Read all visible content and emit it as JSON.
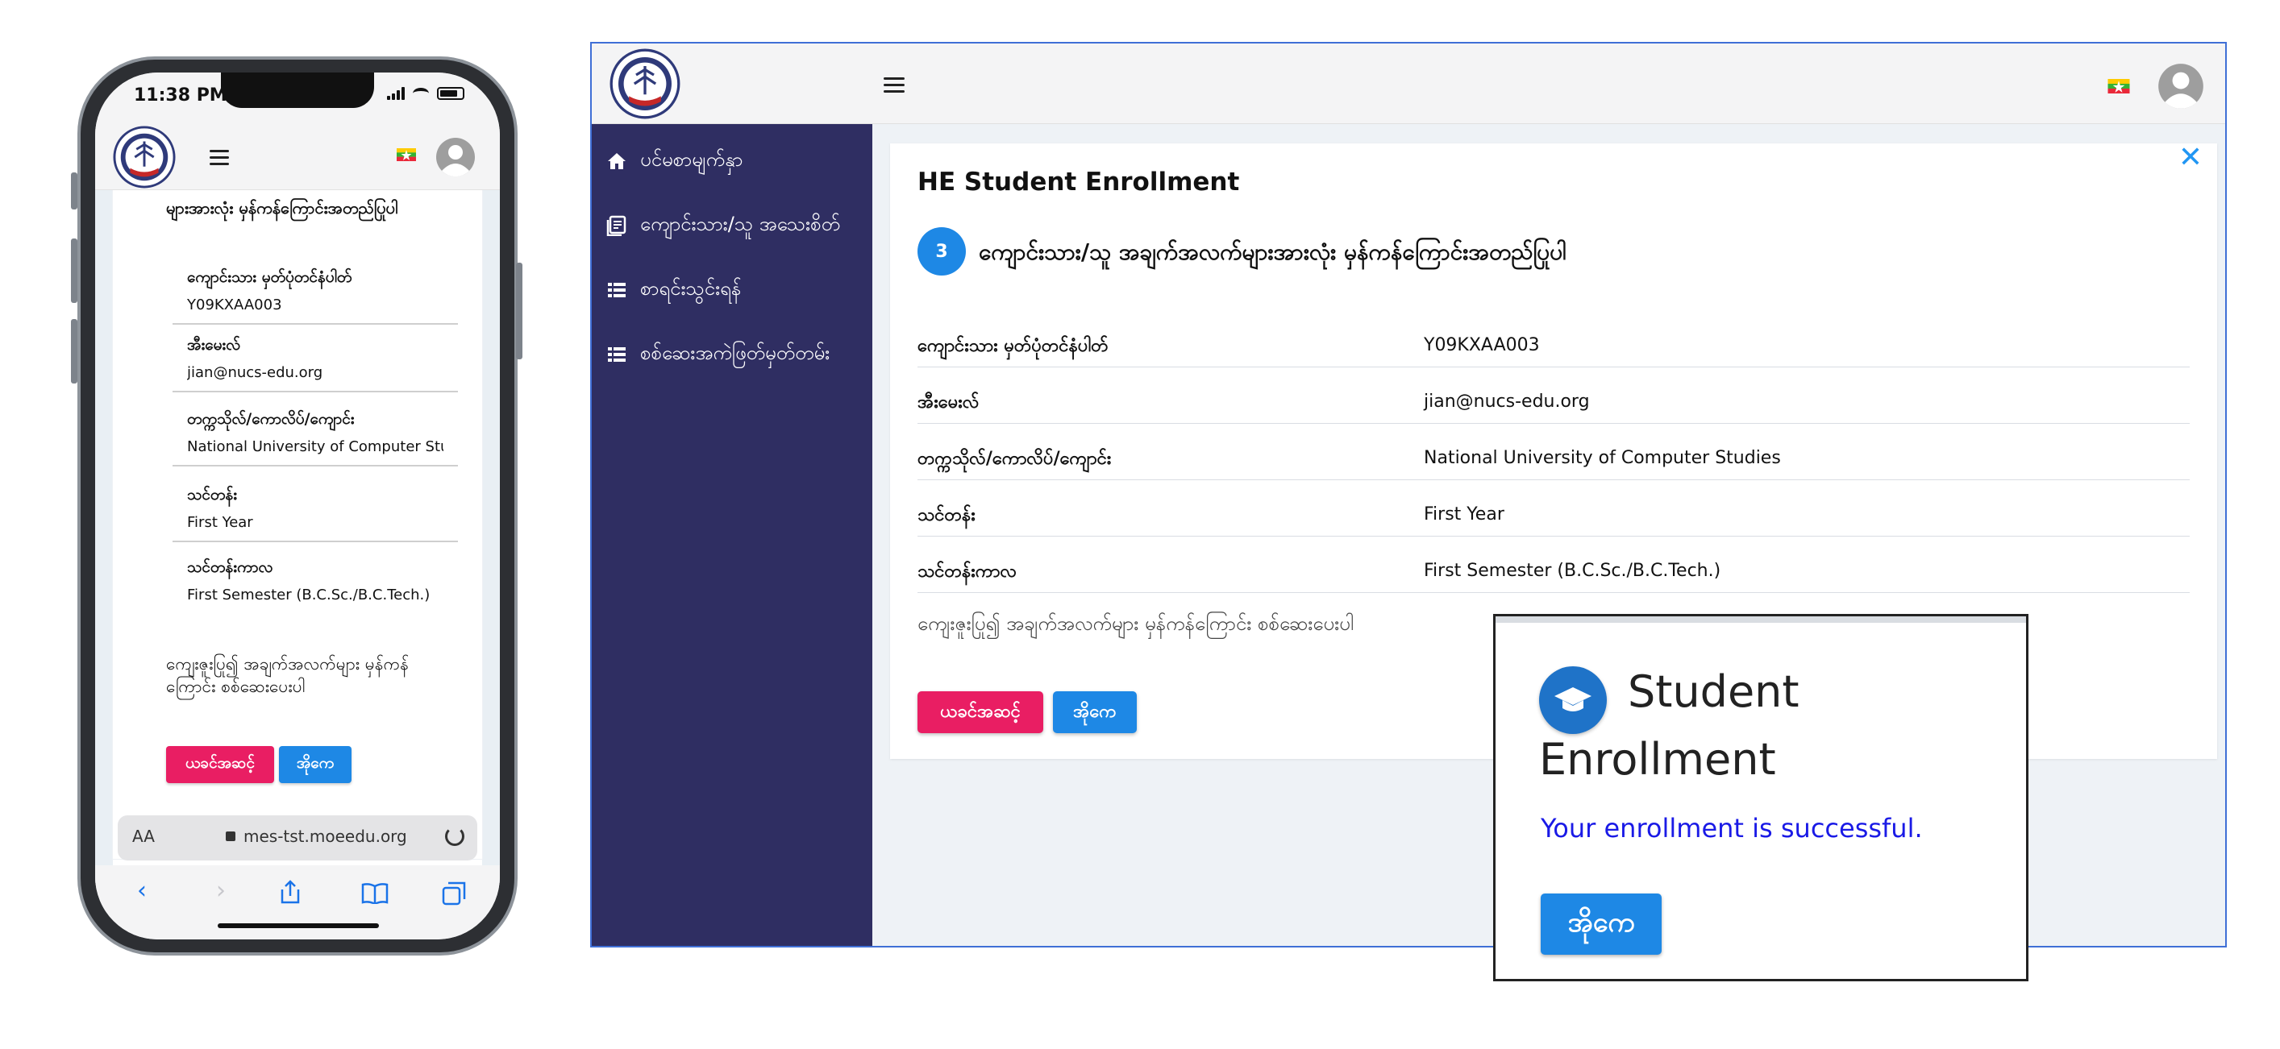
{
  "colors": {
    "primary": "#1e88e5",
    "danger": "#e91e63",
    "sidebar": "#2f2e62",
    "success_text": "#1a1ae6"
  },
  "mobile": {
    "status": {
      "time": "11:38 PM"
    },
    "step_title": "များအားလုံး မှန်ကန်ကြောင်းအတည်ပြုပါ",
    "fields": [
      {
        "label": "ကျောင်းသား မှတ်ပုံတင်နံပါတ်",
        "value": "Y09KXAA003"
      },
      {
        "label": "အီးမေးလ်",
        "value": "jian@nucs-edu.org"
      },
      {
        "label": "တက္ကသိုလ်/ကောလိပ်/ကျောင်း",
        "value": "National University of Computer Studi"
      },
      {
        "label": "သင်တန်း",
        "value": "First Year"
      },
      {
        "label": "သင်တန်းကာလ",
        "value": "First Semester (B.C.Sc./B.C.Tech.)"
      }
    ],
    "confirm_text": "ကျေးဇူးပြု၍ အချက်အလက်များ မှန်ကန်ကြောင်း စစ်ဆေးပေးပါ",
    "back_label": "ယခင်အဆင့်",
    "ok_label": "အိုကေ",
    "browser": {
      "text_size": "AA",
      "url": "mes-tst.moeedu.org"
    }
  },
  "desktop": {
    "nav": [
      {
        "label": "ပင်မစာမျက်နှာ",
        "icon": "home-icon"
      },
      {
        "label": "ကျောင်းသား/သူ အသေးစိတ်",
        "icon": "document-icon"
      },
      {
        "label": "စာရင်းသွင်းရန်",
        "icon": "list-icon"
      },
      {
        "label": "စစ်ဆေးအကဲဖြတ်မှတ်တမ်း",
        "icon": "list-icon"
      }
    ],
    "card": {
      "title": "HE Student Enrollment",
      "step_number": "3",
      "step_text": "ကျောင်းသား/သူ အချက်အလက်များအားလုံး မှန်ကန်ကြောင်းအတည်ပြုပါ",
      "rows": [
        {
          "label": "ကျောင်းသား မှတ်ပုံတင်နံပါတ်",
          "value": "Y09KXAA003"
        },
        {
          "label": "အီးမေးလ်",
          "value": "jian@nucs-edu.org"
        },
        {
          "label": "တက္ကသိုလ်/ကောလိပ်/ကျောင်း",
          "value": "National University of Computer Studies"
        },
        {
          "label": "သင်တန်း",
          "value": "First Year"
        },
        {
          "label": "သင်တန်းကာလ",
          "value": "First Semester (B.C.Sc./B.C.Tech.)"
        }
      ],
      "confirm_text": "ကျေးဇူးပြု၍ အချက်အလက်များ မှန်ကန်ကြောင်း စစ်ဆေးပေးပါ",
      "back_label": "ယခင်အဆင့်",
      "ok_label": "အိုကေ"
    }
  },
  "popup": {
    "title": "Student Enrollment",
    "message": "Your enrollment is successful.",
    "ok_label": "အိုကေ"
  }
}
